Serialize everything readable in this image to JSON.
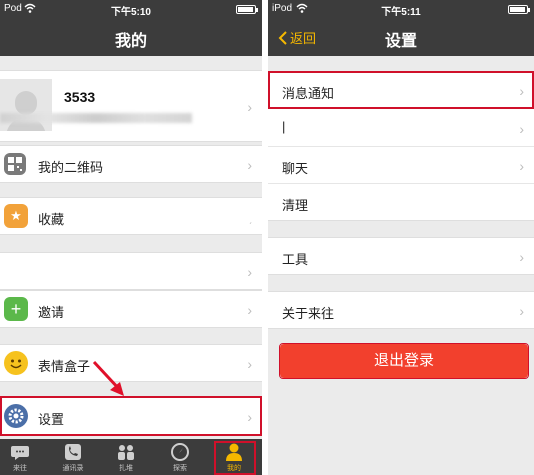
{
  "left": {
    "status": {
      "carrier": "Pod",
      "time": "下午5:10"
    },
    "nav_title": "我的",
    "profile": {
      "name": "3533",
      "chevron": "›"
    },
    "rows": {
      "qrcode": "我的二维码",
      "favorites": "收藏",
      "invite": "邀请",
      "stickers": "表情盒子",
      "settings": "设置"
    },
    "chevron": "›",
    "tabs": [
      "来往",
      "通讯录",
      "扎堆",
      "探索",
      "我的"
    ]
  },
  "right": {
    "status": {
      "carrier": "iPod",
      "time": "下午5:11"
    },
    "nav_title": "设置",
    "back_label": "返回",
    "rows": {
      "notifications": "消息通知",
      "blank": "|",
      "chat": "聊天",
      "clean": "清理",
      "tools": "工具",
      "about": "关于来往"
    },
    "chevron": "›",
    "logout_label": "退出登录"
  },
  "colors": {
    "bar_bg": "#3c3c3c",
    "accent_yellow": "#f5b800",
    "highlight_red": "#d0102a",
    "logout_red": "#f2402d",
    "page_bg": "#ebebeb"
  },
  "icons": {
    "qrcode": "qrcode-icon",
    "favorites": "star-bookmark-icon",
    "invite": "plus-icon",
    "stickers": "smiley-icon",
    "settings": "gear-icon"
  }
}
